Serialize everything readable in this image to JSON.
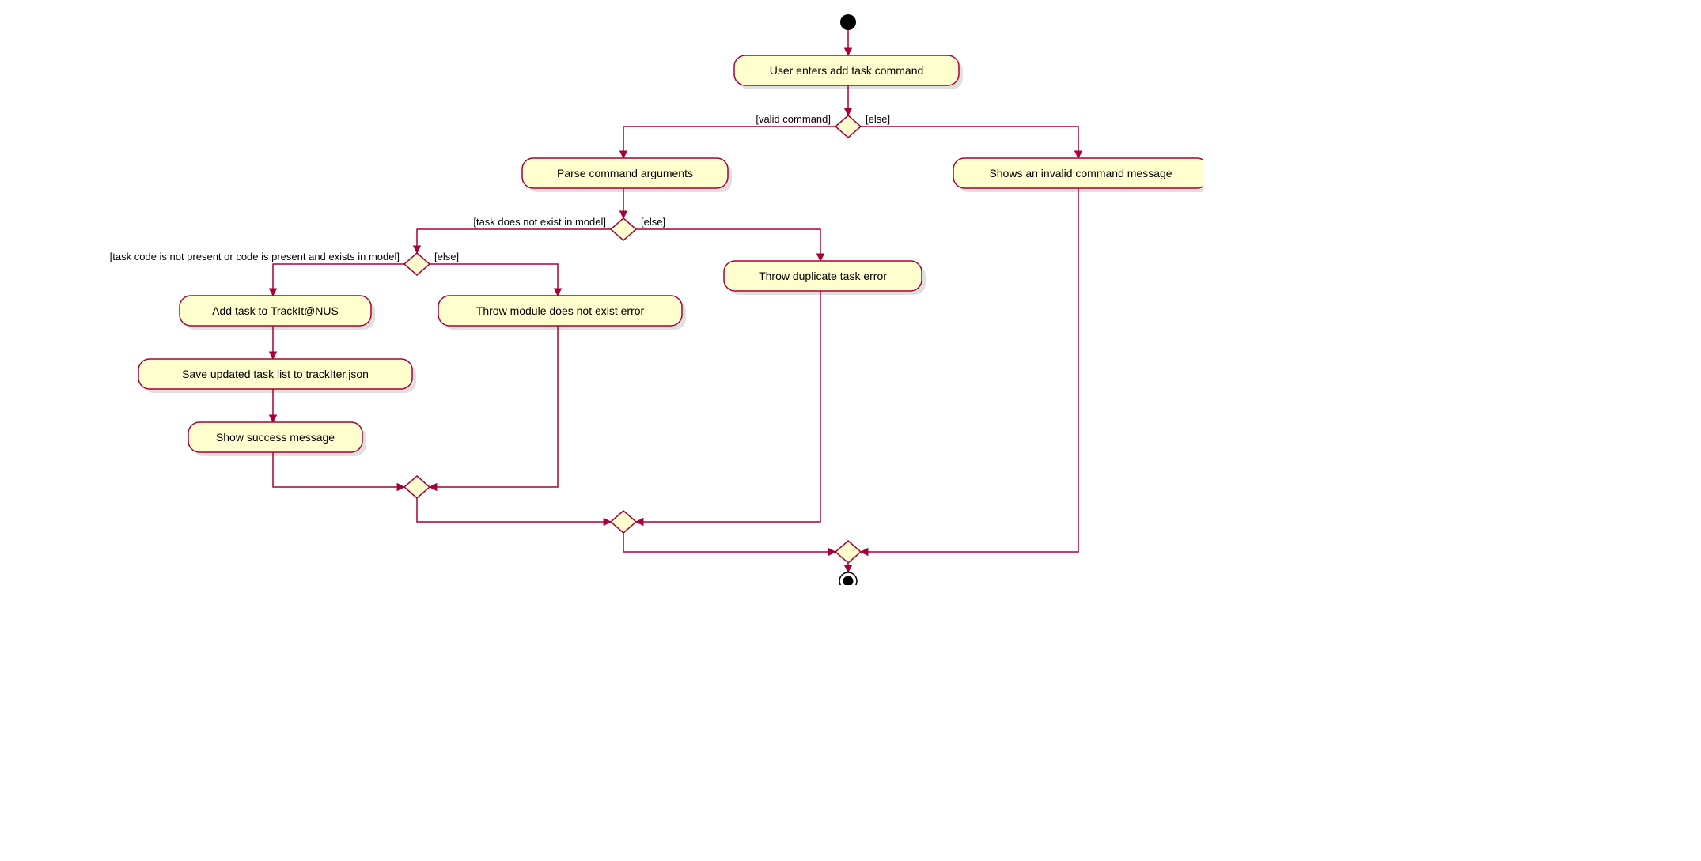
{
  "nodes": {
    "start": {
      "kind": "initial"
    },
    "a_user_enters": {
      "label": "User enters add task command"
    },
    "d_valid": {
      "kind": "decision",
      "left_guard": "[valid command]",
      "right_guard": "[else]"
    },
    "a_parse": {
      "label": "Parse command arguments"
    },
    "a_invalid_msg": {
      "label": "Shows an invalid command message"
    },
    "d_taskexists": {
      "kind": "decision",
      "left_guard": "[task does not exist in model]",
      "right_guard": "[else]"
    },
    "a_dup": {
      "label": "Throw duplicate task error"
    },
    "d_code": {
      "kind": "decision",
      "left_guard": "[task code is not present or code is present and exists in model]",
      "right_guard": "[else]"
    },
    "a_add": {
      "label": "Add task to TrackIt@NUS"
    },
    "a_nomodule": {
      "label": "Throw module does not exist error"
    },
    "a_save": {
      "label": "Save updated task list to trackIter.json"
    },
    "a_success": {
      "label": "Show success message"
    },
    "m1": {
      "kind": "merge"
    },
    "m2": {
      "kind": "merge"
    },
    "m3": {
      "kind": "merge"
    },
    "end": {
      "kind": "final"
    }
  }
}
